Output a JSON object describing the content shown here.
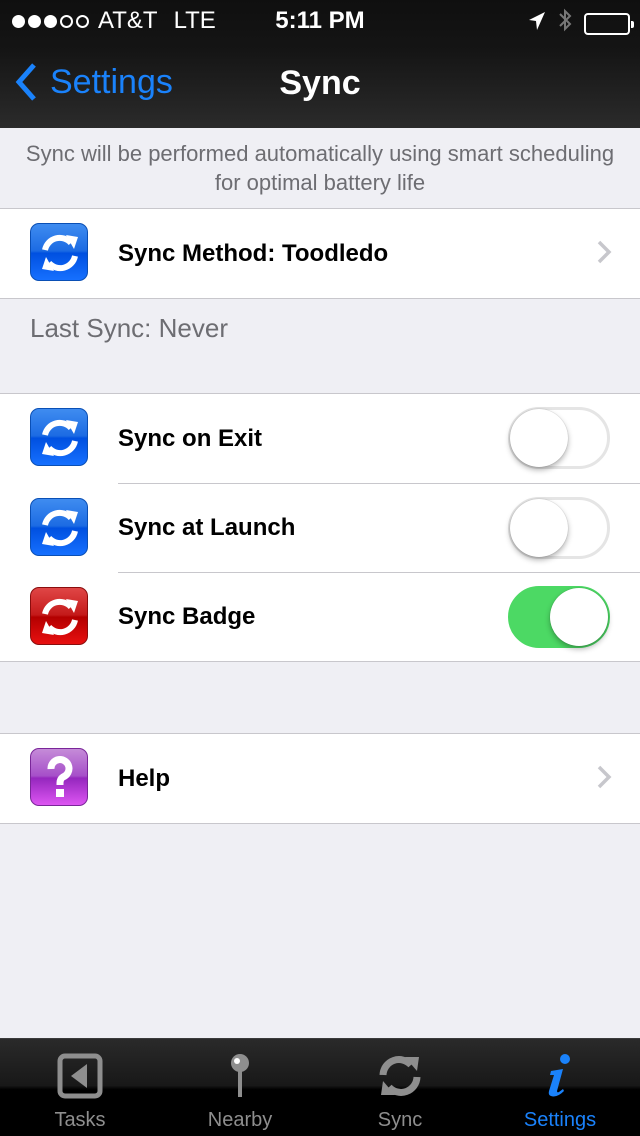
{
  "status_bar": {
    "signal_bars_filled": 3,
    "signal_bars_total": 5,
    "carrier": "AT&T",
    "network": "LTE",
    "time": "5:11 PM",
    "icons": [
      "location-arrow-icon",
      "bluetooth-icon",
      "battery-icon"
    ]
  },
  "nav": {
    "back_label": "Settings",
    "title": "Sync"
  },
  "info_text": "Sync will be performed automatically using smart scheduling for optimal battery life",
  "sync_method": {
    "label": "Sync Method: Toodledo",
    "icon": "sync-icon",
    "icon_color": "#1c6be3"
  },
  "last_sync": "Last Sync: Never",
  "toggles": [
    {
      "label": "Sync on Exit",
      "icon": "sync-icon",
      "icon_color": "#1c6be3",
      "on": false
    },
    {
      "label": "Sync at Launch",
      "icon": "sync-icon",
      "icon_color": "#1c6be3",
      "on": false
    },
    {
      "label": "Sync Badge",
      "icon": "sync-icon",
      "icon_color": "#c41a1a",
      "on": true
    }
  ],
  "help": {
    "label": "Help",
    "icon": "question-icon",
    "icon_color": "#a64fc9"
  },
  "tabbar": {
    "tabs": [
      {
        "label": "Tasks",
        "icon": "tasks-icon",
        "active": false
      },
      {
        "label": "Nearby",
        "icon": "pin-icon",
        "active": false
      },
      {
        "label": "Sync",
        "icon": "sync-icon",
        "active": false
      },
      {
        "label": "Settings",
        "icon": "info-icon",
        "active": true
      }
    ]
  },
  "colors": {
    "accent": "#1a82fb",
    "toggle_on": "#4cd964",
    "background": "#efeff4",
    "inactive_tab": "#8e8e8e"
  }
}
